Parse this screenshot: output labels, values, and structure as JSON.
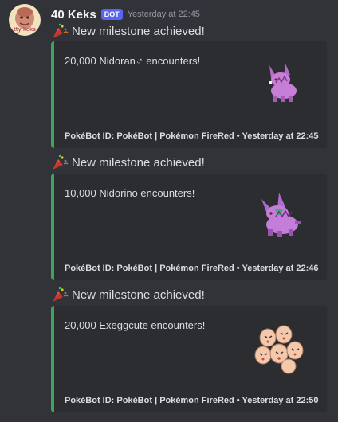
{
  "author": {
    "name": "40 Keks",
    "badge": "BOT",
    "timestamp": "Yesterday at 22:45",
    "avatar_text": "tty keks"
  },
  "messages": [
    {
      "text": "New milestone achieved!",
      "icon": "party-popper-icon",
      "embed": {
        "accent": "#3ba55c",
        "description": "20,000 Nidoran♂ encounters!",
        "sprite": "nidoran-male-sprite",
        "footer": "PokéBot ID: PokéBot | Pokémon FireRed • Yesterday at 22:45"
      }
    },
    {
      "text": "New milestone achieved!",
      "icon": "party-popper-icon",
      "embed": {
        "accent": "#3ba55c",
        "description": "10,000 Nidorino encounters!",
        "sprite": "nidorino-sprite",
        "footer": "PokéBot ID: PokéBot | Pokémon FireRed • Yesterday at 22:46"
      }
    },
    {
      "text": "New milestone achieved!",
      "icon": "party-popper-icon",
      "embed": {
        "accent": "#3ba55c",
        "description": "20,000 Exeggcute encounters!",
        "sprite": "exeggcute-sprite",
        "footer": "PokéBot ID: PokéBot | Pokémon FireRed • Yesterday at 22:50"
      }
    }
  ]
}
